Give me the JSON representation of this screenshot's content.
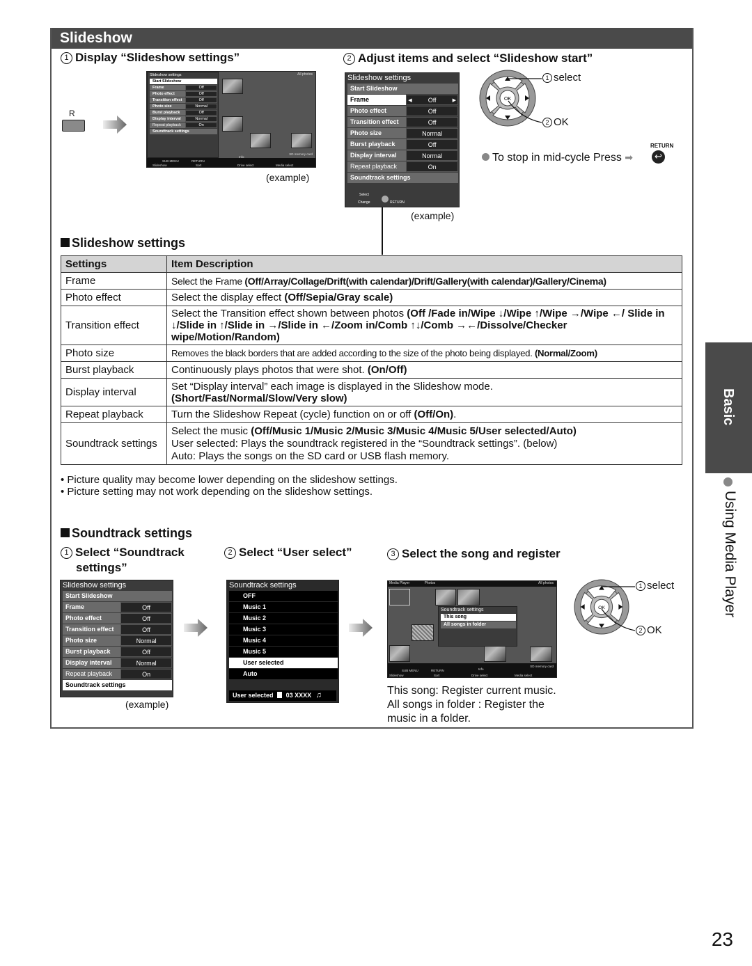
{
  "page": {
    "title": "Slideshow",
    "page_number": "23",
    "side_tab": "Basic",
    "side_caption": "Using Media Player"
  },
  "step1": {
    "num": "1",
    "title": "Display “Slideshow settings”",
    "button_label": "R",
    "example": "(example)",
    "screen": {
      "menu_title": "Slideshow settings",
      "top_right": "All photos",
      "items": [
        {
          "label": "Start Slideshow",
          "value": ""
        },
        {
          "label": "Frame",
          "value": "Off"
        },
        {
          "label": "Photo effect",
          "value": "Off"
        },
        {
          "label": "Transition effect",
          "value": "Off"
        },
        {
          "label": "Photo size",
          "value": "Normal"
        },
        {
          "label": "Burst playback",
          "value": "Off"
        },
        {
          "label": "Display interval",
          "value": "Normal"
        },
        {
          "label": "Repeat playback",
          "value": "On"
        },
        {
          "label": "Soundtrack settings",
          "value": ""
        }
      ],
      "footer": {
        "sub_menu": "SUB MENU",
        "return": "RETURN",
        "info": "Info",
        "storage": "SD memory card",
        "slideshow": "Slideshow",
        "sort": "Sort",
        "drive_select": "Drive select",
        "media_select": "Media select"
      }
    }
  },
  "step2": {
    "num": "2",
    "title": "Adjust items and select “Slideshow start”",
    "example": "(example)",
    "menu": {
      "title": "Slideshow settings",
      "items": [
        {
          "label": "Start Slideshow",
          "value": ""
        },
        {
          "label": "Frame",
          "value": "Off"
        },
        {
          "label": "Photo effect",
          "value": "Off"
        },
        {
          "label": "Transition effect",
          "value": "Off"
        },
        {
          "label": "Photo size",
          "value": "Normal"
        },
        {
          "label": "Burst playback",
          "value": "Off"
        },
        {
          "label": "Display interval",
          "value": "Normal"
        },
        {
          "label": "Repeat playback",
          "value": "On"
        },
        {
          "label": "Soundtrack settings",
          "value": ""
        }
      ],
      "footer_select": "Select",
      "footer_change": "Change",
      "footer_return": "RETURN"
    },
    "dpad": {
      "ok": "OK",
      "select_label": "select",
      "ok_label": "OK",
      "select_num": "1",
      "ok_num": "2"
    },
    "stop_note": "To stop in mid-cycle Press",
    "return_label": "RETURN"
  },
  "settings_section": {
    "title": "Slideshow settings",
    "headers": [
      "Settings",
      "Item Description"
    ],
    "rows": [
      {
        "setting": "Frame",
        "desc": "Select the Frame ",
        "options": "(Off/Array/Collage/Drift(with calendar)/Drift/Gallery(with calendar)/Gallery/Cinema)"
      },
      {
        "setting": "Photo effect",
        "desc": "Select the display effect ",
        "options": "(Off/Sepia/Gray scale)"
      },
      {
        "setting": "Transition effect",
        "desc": "Select the Transition effect shown between photos ",
        "options": "(Off /Fade in/Wipe ↓/Wipe ↑/Wipe →/Wipe ←/ Slide in ↓/Slide in ↑/Slide in →/Slide in ←/Zoom in/Comb ↑↓/Comb →←/Dissolve/Checker wipe/Motion/Random)"
      },
      {
        "setting": "Photo size",
        "desc": "Removes the black borders that are added according to the size of the photo being displayed. ",
        "options": "(Normal/Zoom)"
      },
      {
        "setting": "Burst playback",
        "desc": "Continuously plays photos that were shot. ",
        "options": "(On/Off)"
      },
      {
        "setting": "Display interval",
        "desc": "Set “Display interval” each image is displayed in the Slideshow mode.",
        "options": "(Short/Fast/Normal/Slow/Very slow)"
      },
      {
        "setting": "Repeat playback",
        "desc": "Turn the Slideshow Repeat (cycle) function on or off ",
        "options": "(Off/On)",
        "suffix": "."
      },
      {
        "setting": "Soundtrack settings",
        "desc": "Select the music ",
        "options": "(Off/Music 1/Music 2/Music 3/Music 4/Music 5/User selected/Auto)",
        "line2": "User selected: Plays the soundtrack registered in the “Soundtrack settings”. (below)",
        "line3": "Auto: Plays the songs on the SD card or USB flash memory."
      }
    ],
    "notes": [
      "Picture quality may become lower depending on the slideshow settings.",
      "Picture setting may not work depending on the slideshow settings."
    ]
  },
  "soundtrack_section": {
    "title": "Soundtrack settings",
    "step1": {
      "num": "1",
      "title_line1": "Select “Soundtrack",
      "title_line2": "settings”",
      "example": "(example)",
      "menu": {
        "title": "Slideshow settings",
        "items": [
          {
            "label": "Start Slideshow",
            "value": ""
          },
          {
            "label": "Frame",
            "value": "Off"
          },
          {
            "label": "Photo effect",
            "value": "Off"
          },
          {
            "label": "Transition effect",
            "value": "Off"
          },
          {
            "label": "Photo size",
            "value": "Normal"
          },
          {
            "label": "Burst playback",
            "value": "Off"
          },
          {
            "label": "Display interval",
            "value": "Normal"
          },
          {
            "label": "Repeat playback",
            "value": "On"
          },
          {
            "label": "Soundtrack settings",
            "value": ""
          }
        ]
      }
    },
    "step2": {
      "num": "2",
      "title": "Select “User select”",
      "menu": {
        "title": "Soundtrack settings",
        "items": [
          "OFF",
          "Music 1",
          "Music 2",
          "Music 3",
          "Music 4",
          "Music 5",
          "User selected",
          "Auto"
        ],
        "selected": "User selected",
        "footer_label": "User selected",
        "footer_file": "03 XXXX"
      }
    },
    "step3": {
      "num": "3",
      "title": "Select the song and register",
      "screen": {
        "app": "Media Player",
        "category": "Photos",
        "top_right": "All photos",
        "popup_title": "Soundtrack settings",
        "popup_items": [
          "This song",
          "All songs in folder"
        ],
        "storage": "SD memory card"
      },
      "dpad": {
        "ok": "OK",
        "select_label": "select",
        "ok_label": "OK",
        "select_num": "1",
        "ok_num": "2"
      },
      "desc_lines": [
        "This song: Register current music.",
        "All songs in folder : Register the",
        "music in a folder."
      ]
    }
  }
}
